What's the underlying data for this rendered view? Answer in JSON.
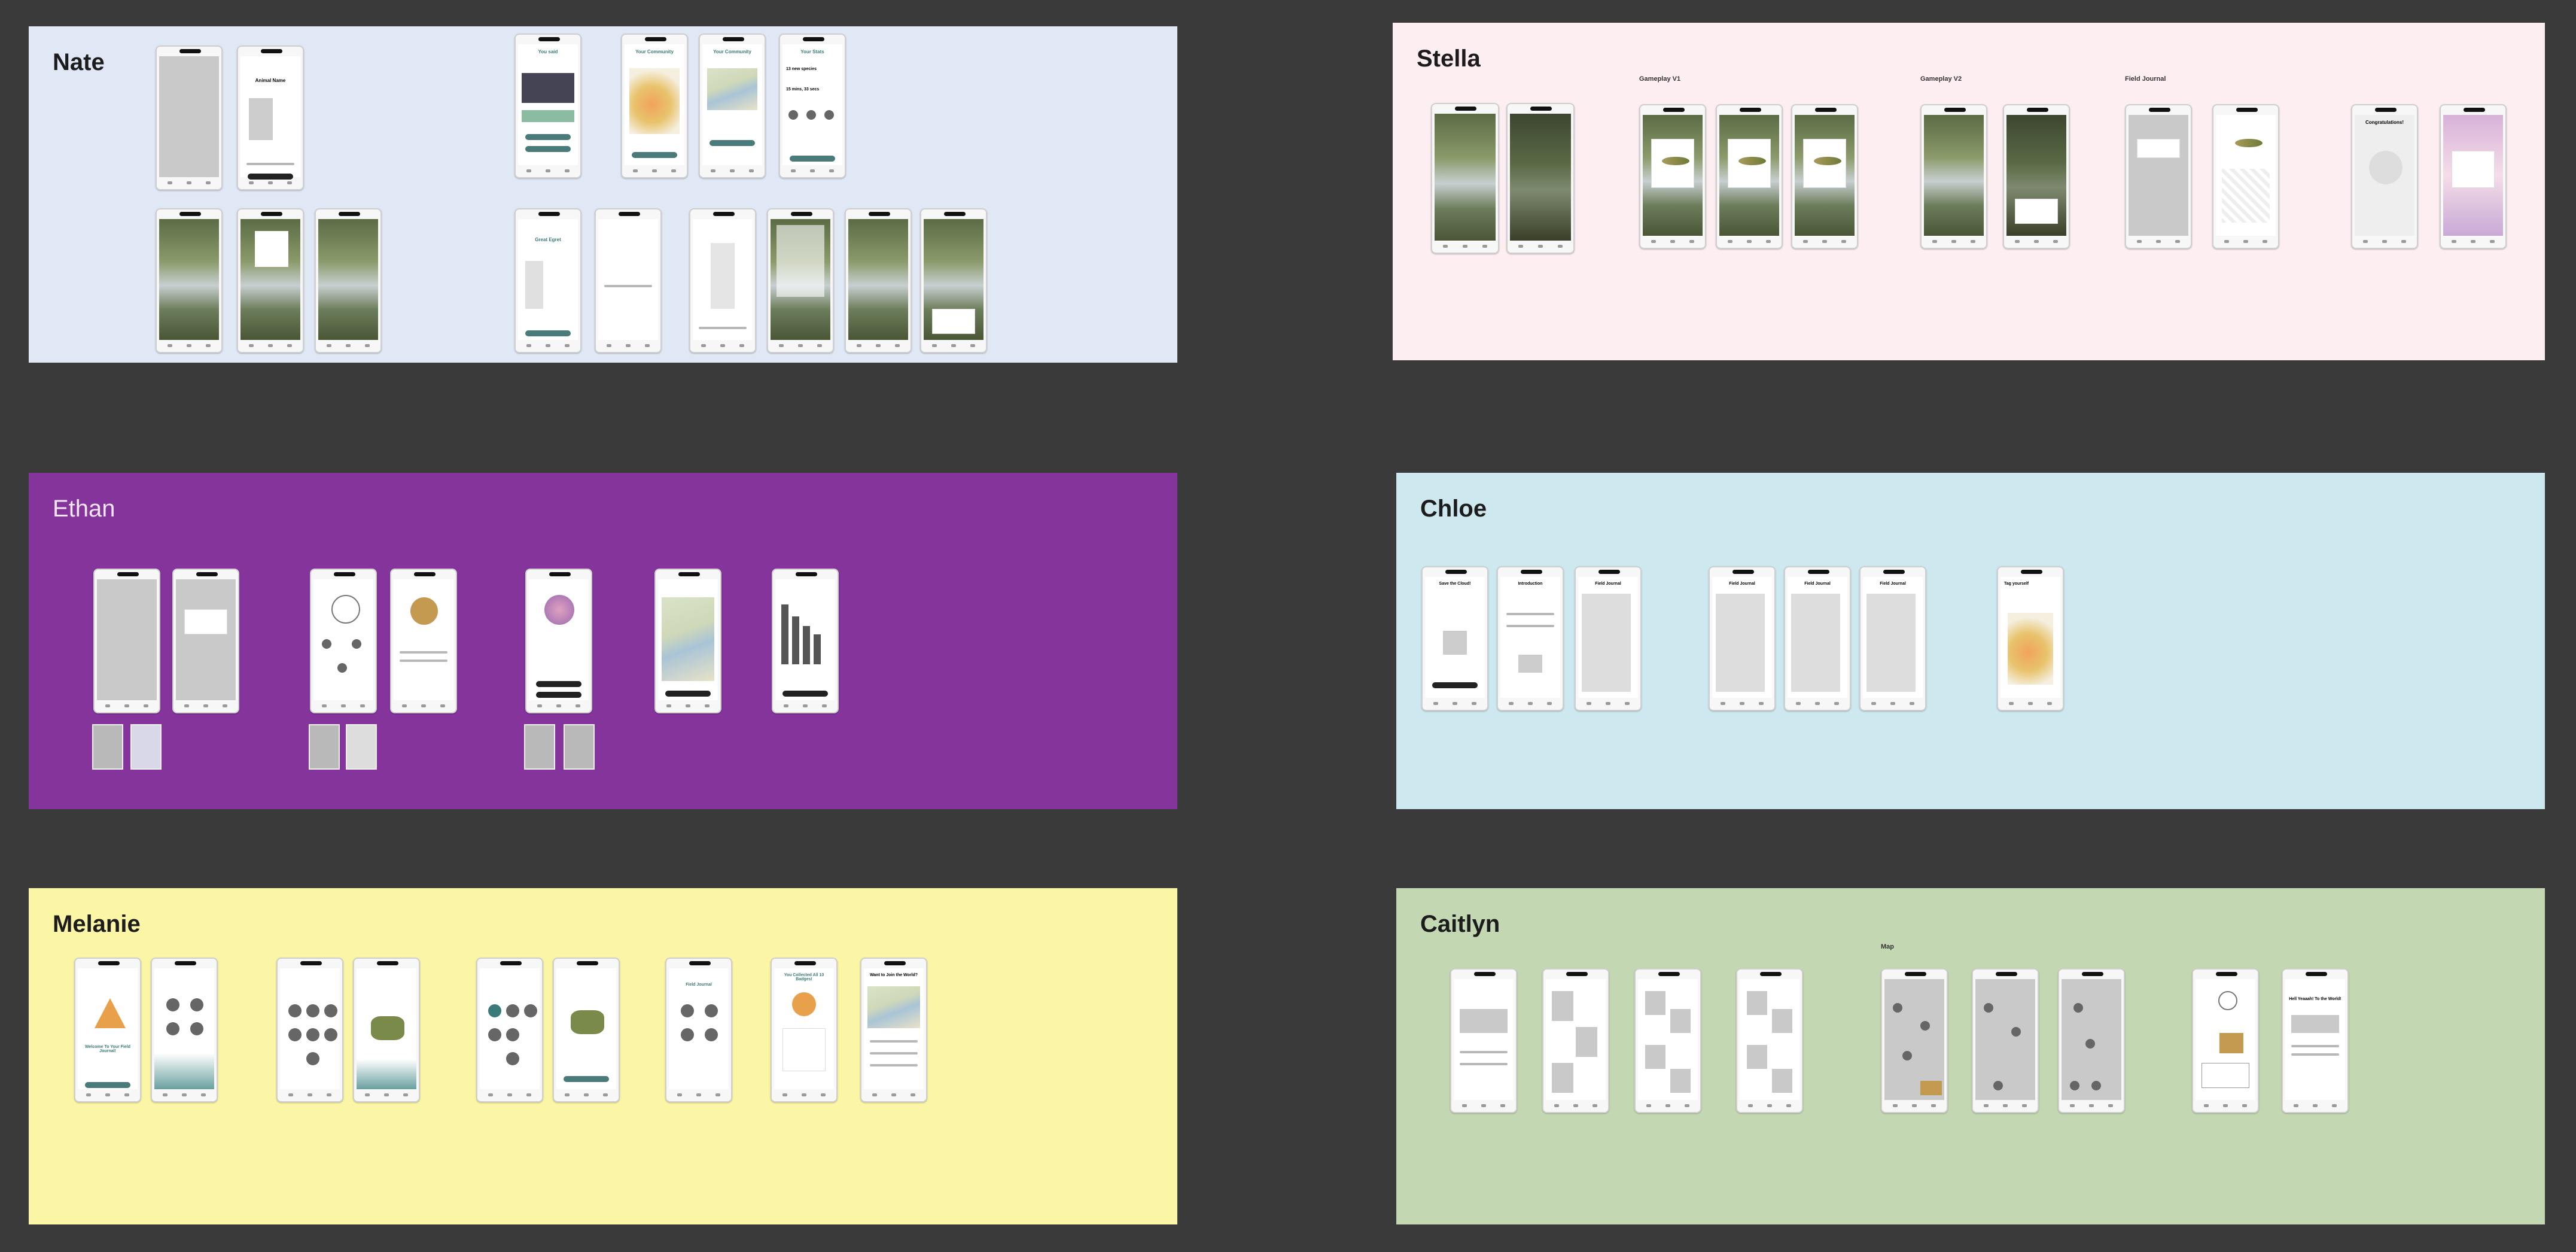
{
  "board": {
    "sections": [
      {
        "name": "Nate",
        "bg": "#e1e8f5"
      },
      {
        "name": "Stella",
        "bg": "#fdeef2"
      },
      {
        "name": "Ethan",
        "bg": "#84349a"
      },
      {
        "name": "Chloe",
        "bg": "#cde9ef"
      },
      {
        "name": "Melanie",
        "bg": "#fbf5a6"
      },
      {
        "name": "Caitlyn",
        "bg": "#c3d8b2"
      }
    ],
    "stella_labels": {
      "v1": "Gameplay V1",
      "v2": "Gameplay V2",
      "journal": "Field Journal"
    },
    "caitlyn_labels": {
      "map": "Map"
    },
    "nate_screens": {
      "animal": "Animal Name",
      "you_said": "You said",
      "community1": "Your Community",
      "community2": "Your Community",
      "stats": "Your Stats",
      "stats_species": "13 new species",
      "stats_time": "15 mins, 33 secs",
      "egret": "Great Egret"
    },
    "stella_screens": {
      "congrats": "Congratulations!"
    },
    "chloe_screens": {
      "save": "Save the Cloud!",
      "intro": "Introduction",
      "journal1": "Field Journal",
      "journal2": "Field Journal",
      "journal3": "Field Journal",
      "journal4": "Field Journal",
      "yourself": "Tag yourself"
    },
    "melanie_screens": {
      "welcome": "Welcome To Your Field Journal!",
      "collected": "You Collected All 10 Badges!",
      "world": "Want to Join the World?",
      "field_journal": "Field Journal"
    },
    "caitlyn_screens": {
      "world": "Hell Yeaaah! To the World!"
    }
  }
}
